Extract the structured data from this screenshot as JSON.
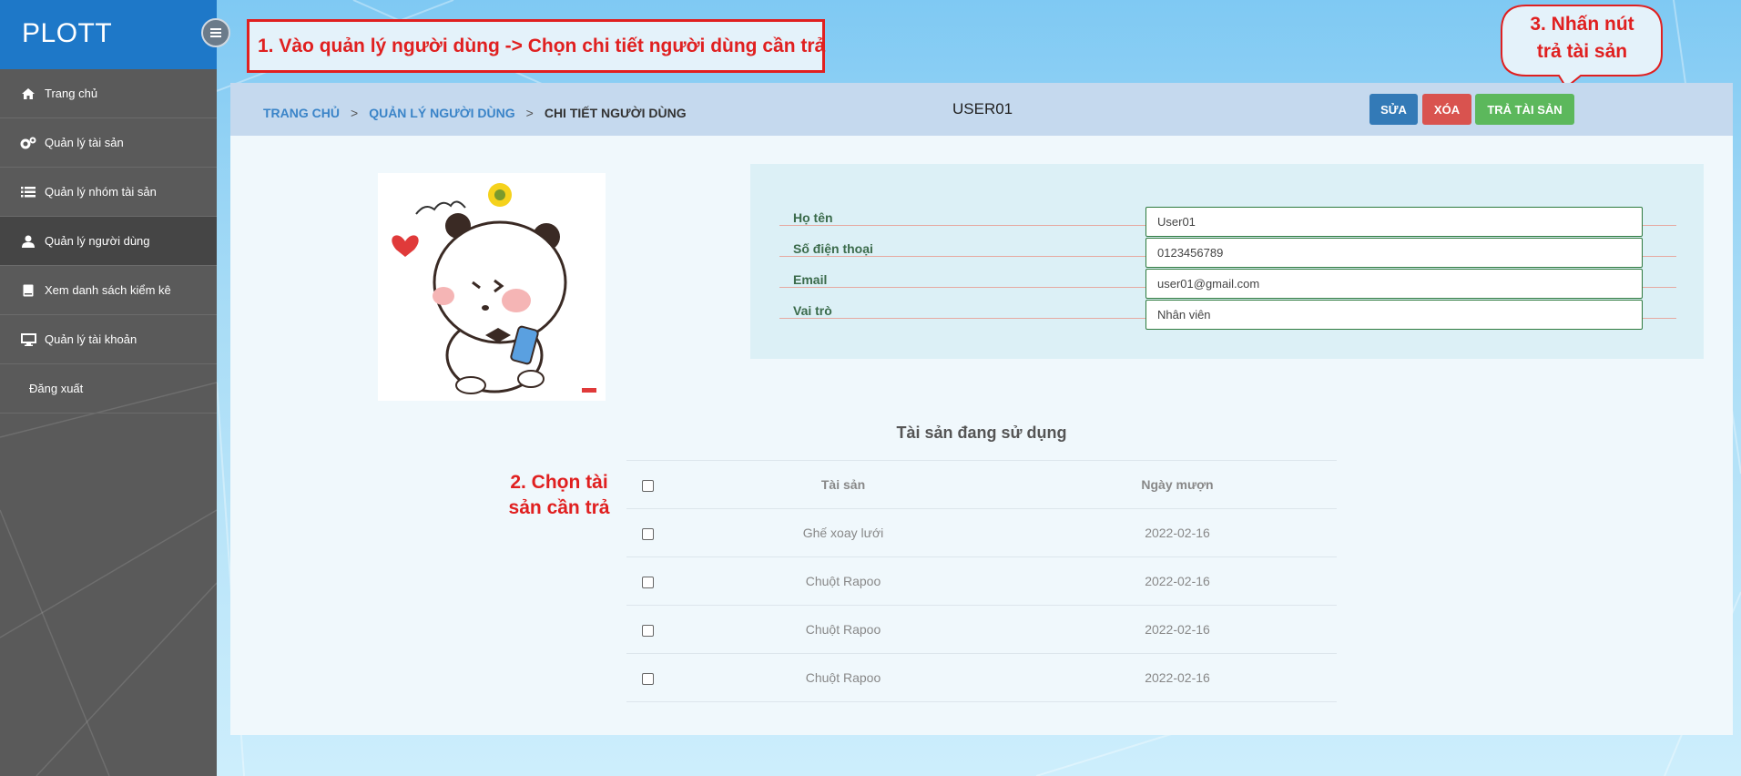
{
  "sidebar": {
    "brand": "PLOTT",
    "items": [
      {
        "label": "Trang chủ",
        "icon": "home-icon"
      },
      {
        "label": "Quản lý tài sản",
        "icon": "gears-icon"
      },
      {
        "label": "Quản lý nhóm tài sản",
        "icon": "list-icon"
      },
      {
        "label": "Quản lý người dùng",
        "icon": "user-icon",
        "active": true
      },
      {
        "label": "Xem danh sách kiểm kê",
        "icon": "book-icon"
      },
      {
        "label": "Quản lý tài khoản",
        "icon": "desktop-icon"
      },
      {
        "label": "Đăng xuất",
        "icon": ""
      }
    ]
  },
  "annotations": {
    "step1": "1. Vào quản lý người dùng -> Chọn chi tiết người dùng cần trả",
    "step2_line1": "2. Chọn tài",
    "step2_line2": "sản cần trả",
    "step3_line1": "3. Nhấn nút",
    "step3_line2": "trả tài sản"
  },
  "breadcrumb": {
    "home": "TRANG CHỦ",
    "sep": ">",
    "users": "QUẢN LÝ NGƯỜI DÙNG",
    "current": "CHI TIẾT NGƯỜI DÙNG"
  },
  "page": {
    "title": "USER01"
  },
  "toolbar": {
    "edit": "SỬA",
    "delete": "XÓA",
    "return": "TRẢ TÀI SẢN"
  },
  "user_info": {
    "name_label": "Họ tên",
    "name_value": "User01",
    "phone_label": "Số điện thoại",
    "phone_value": "0123456789",
    "email_label": "Email",
    "email_value": "user01@gmail.com",
    "role_label": "Vai trò",
    "role_value": "Nhân viên"
  },
  "assets": {
    "title": "Tài sản đang sử dụng",
    "headers": {
      "asset": "Tài sản",
      "date": "Ngày mượn"
    },
    "rows": [
      {
        "asset": "Ghế xoay lưới",
        "date": "2022-02-16"
      },
      {
        "asset": "Chuột Rapoo",
        "date": "2022-02-16"
      },
      {
        "asset": "Chuột Rapoo",
        "date": "2022-02-16"
      },
      {
        "asset": "Chuột Rapoo",
        "date": "2022-02-16"
      }
    ]
  },
  "colors": {
    "brand": "#1e78c8",
    "sidebar": "#5a5a5a",
    "annotation": "#e02020",
    "edit": "#337ab7",
    "delete": "#d9534f",
    "return": "#5cb85c"
  }
}
